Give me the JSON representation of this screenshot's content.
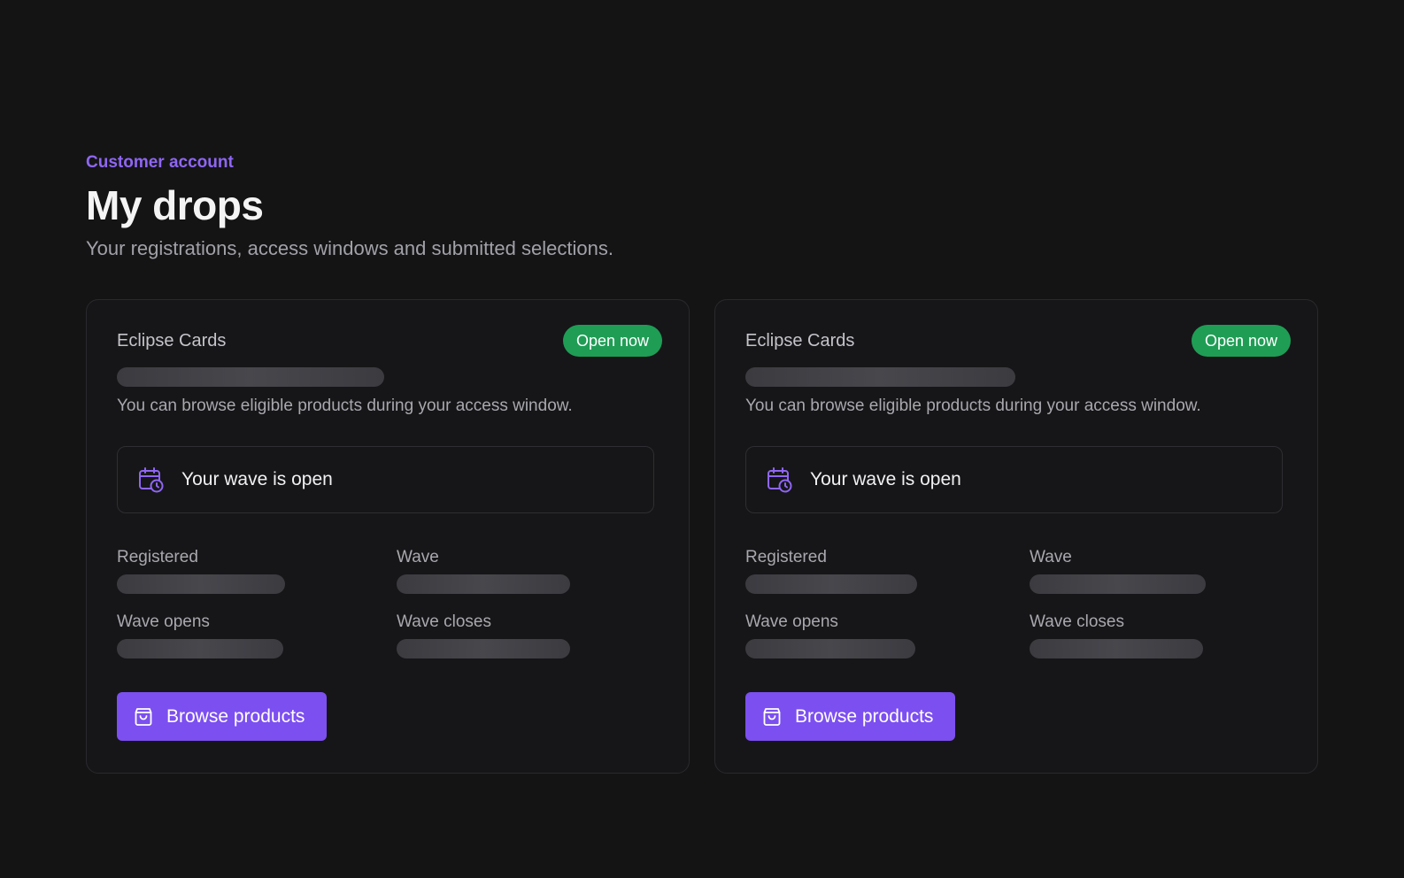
{
  "header": {
    "eyebrow": "Customer account",
    "title": "My drops",
    "subtitle": "Your registrations, access windows and submitted selections."
  },
  "colors": {
    "accent": "#7c4ff0",
    "eyebrow": "#8f66f4",
    "status_open": "#1f9d55",
    "background": "#141415"
  },
  "icons": {
    "wave": "calendar-clock-icon",
    "browse": "shopping-bag-icon"
  },
  "cards": [
    {
      "drop_name": "Eclipse Cards",
      "status": "Open now",
      "description": "You can browse eligible products during your access window.",
      "wave_status": "Your wave is open",
      "fields": {
        "registered_label": "Registered",
        "wave_label": "Wave",
        "wave_opens_label": "Wave opens",
        "wave_closes_label": "Wave closes"
      },
      "browse_label": "Browse products"
    },
    {
      "drop_name": "Eclipse Cards",
      "status": "Open now",
      "description": "You can browse eligible products during your access window.",
      "wave_status": "Your wave is open",
      "fields": {
        "registered_label": "Registered",
        "wave_label": "Wave",
        "wave_opens_label": "Wave opens",
        "wave_closes_label": "Wave closes"
      },
      "browse_label": "Browse products"
    }
  ]
}
